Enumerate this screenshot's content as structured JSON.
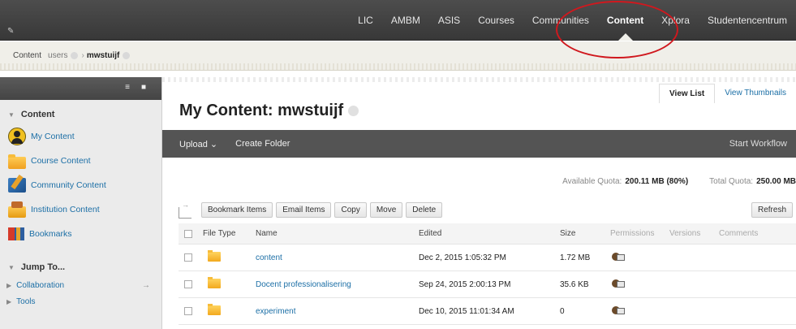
{
  "topnav": {
    "tabs": [
      {
        "label": "LIC"
      },
      {
        "label": "AMBM"
      },
      {
        "label": "ASIS"
      },
      {
        "label": "Courses"
      },
      {
        "label": "Communities"
      },
      {
        "label": "Content",
        "active": true
      },
      {
        "label": "Xplora"
      },
      {
        "label": "Studentencentrum"
      }
    ]
  },
  "breadcrumb": {
    "root": "Content",
    "user": "users",
    "current": "mwstuijf"
  },
  "sidebar": {
    "section_title": "Content",
    "items": [
      {
        "label": "My Content",
        "icon": "user-avatar-icon"
      },
      {
        "label": "Course Content",
        "icon": "folder-icon"
      },
      {
        "label": "Community Content",
        "icon": "community-content-icon"
      },
      {
        "label": "Institution Content",
        "icon": "institution-content-icon"
      },
      {
        "label": "Bookmarks",
        "icon": "bookmarks-icon"
      }
    ],
    "jump_title": "Jump To...",
    "jump_items": [
      {
        "label": "Collaboration"
      },
      {
        "label": "Tools"
      }
    ]
  },
  "main": {
    "view_tabs": [
      "View List",
      "View Thumbnails"
    ],
    "title": "My Content: mwstuijf",
    "actions": {
      "upload": "Upload",
      "create_folder": "Create Folder",
      "start_workflow": "Start Workflow"
    },
    "quota": {
      "available_label": "Available Quota:",
      "available_value": "200.11 MB (80%)",
      "total_label": "Total Quota:",
      "total_value": "250.00 MB"
    },
    "toolbar": {
      "bookmark": "Bookmark Items",
      "email": "Email Items",
      "copy": "Copy",
      "move": "Move",
      "delete": "Delete",
      "refresh": "Refresh"
    },
    "table": {
      "headers": {
        "file_type": "File Type",
        "name": "Name",
        "edited": "Edited",
        "size": "Size",
        "permissions": "Permissions",
        "versions": "Versions",
        "comments": "Comments"
      },
      "rows": [
        {
          "name": "content",
          "edited": "Dec 2, 2015 1:05:32 PM",
          "size": "1.72 MB"
        },
        {
          "name": "Docent professionalisering",
          "edited": "Sep 24, 2015 2:00:13 PM",
          "size": "35.6 KB"
        },
        {
          "name": "experiment",
          "edited": "Dec 10, 2015 11:01:34 AM",
          "size": "0"
        }
      ]
    }
  },
  "colors": {
    "topbar": "#3e3e3e",
    "link": "#1c6fa6",
    "highlight_circle": "#d0181e"
  }
}
